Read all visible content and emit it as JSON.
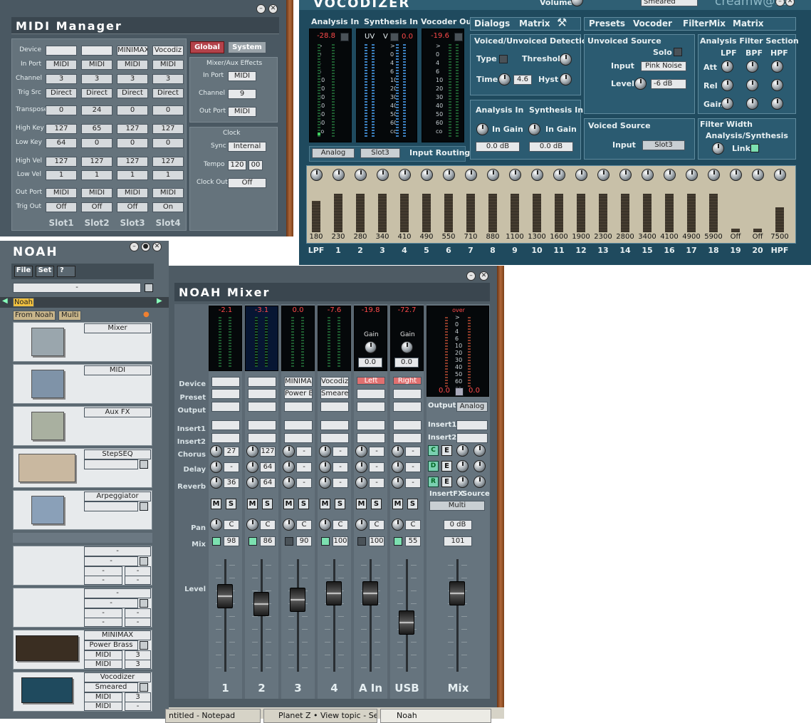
{
  "midi_manager": {
    "title": "MIDI Manager",
    "row_labels": [
      "Device",
      "In Port",
      "Channel",
      "Trig Src",
      "Transpose",
      "High Key",
      "Low Key",
      "High Vel",
      "Low Vel",
      "Out Port",
      "Trig Out"
    ],
    "slots": [
      {
        "name": "Slot1",
        "device": "",
        "in_port": "MIDI",
        "channel": "3",
        "trig_src": "Direct",
        "transpose": "0",
        "high_key": "127",
        "low_key": "64",
        "high_vel": "127",
        "low_vel": "1",
        "out_port": "MIDI",
        "trig_out": "Off"
      },
      {
        "name": "Slot2",
        "device": "",
        "in_port": "MIDI",
        "channel": "3",
        "trig_src": "Direct",
        "transpose": "24",
        "high_key": "65",
        "low_key": "0",
        "high_vel": "127",
        "low_vel": "1",
        "out_port": "MIDI",
        "trig_out": "Off"
      },
      {
        "name": "Slot3",
        "device": "MINIMAX",
        "in_port": "MIDI",
        "channel": "3",
        "trig_src": "Direct",
        "transpose": "0",
        "high_key": "127",
        "low_key": "0",
        "high_vel": "127",
        "low_vel": "1",
        "out_port": "MIDI",
        "trig_out": "Off"
      },
      {
        "name": "Slot4",
        "device": "Vocodiz",
        "in_port": "MIDI",
        "channel": "3",
        "trig_src": "Direct",
        "transpose": "0",
        "high_key": "127",
        "low_key": "0",
        "high_vel": "127",
        "low_vel": "1",
        "out_port": "MIDI",
        "trig_out": "On"
      }
    ],
    "global_btn": "Global",
    "system_btn": "System",
    "aux": {
      "title": "Mixer/Aux Effects",
      "in_port_label": "In Port",
      "in_port": "MIDI",
      "channel_label": "Channel",
      "channel": "9",
      "out_port_label": "Out Port",
      "out_port": "MIDI"
    },
    "clock": {
      "title": "Clock",
      "sync_label": "Sync",
      "sync": "Internal",
      "tempo_label": "Tempo",
      "tempo": "120",
      "tempo_frac": "00",
      "clock_out_label": "Clock Out",
      "clock_out": "Off"
    }
  },
  "vocodizer": {
    "title": "VOCODIZER",
    "volume_label": "Volume",
    "preset_field": "Smeared",
    "brand": "creamw@re",
    "analysis_in": {
      "label": "Analysis In",
      "peak": "-28.8"
    },
    "synthesis_in": {
      "label": "Synthesis In",
      "uv": "UV",
      "v": "V",
      "peak": "0.0"
    },
    "vocoder_out": {
      "label": "Vocoder Out",
      "peak": "-19.6"
    },
    "scale": [
      ">",
      "0",
      "4",
      "6",
      "10",
      "20",
      "30",
      "40",
      "50",
      "60",
      "co"
    ],
    "routing": {
      "analog": "Analog",
      "slot": "Slot3",
      "label": "Input Routing"
    },
    "tabs_left": [
      "Dialogs",
      "Matrix"
    ],
    "tabs_right": [
      "Presets",
      "Vocoder",
      "FilterMix",
      "Matrix"
    ],
    "vuv": {
      "title": "Voiced/Unvoiced Detection",
      "type": "Type",
      "threshold": "Threshold",
      "time": "Time",
      "time_val": "4.6",
      "hyst": "Hyst"
    },
    "unvoiced": {
      "title": "Unvoiced Source",
      "solo": "Solo",
      "input_label": "Input",
      "input": "Pink Noise",
      "level_label": "Level",
      "level": "-6 dB"
    },
    "analysis_filter": {
      "title": "Analysis Filter Section",
      "cols": [
        "LPF",
        "BPF",
        "HPF"
      ],
      "rows": [
        "Att",
        "Rel",
        "Gain"
      ]
    },
    "gain": {
      "analysis_title": "Analysis In",
      "synthesis_title": "Synthesis In",
      "in_gain": "In Gain",
      "analysis_val": "0.0 dB",
      "synthesis_val": "0.0 dB"
    },
    "voiced": {
      "title": "Voiced Source",
      "input_label": "Input",
      "input": "Slot3"
    },
    "width": {
      "title": "Filter Width",
      "sub": "Analysis/Synthesis",
      "link": "Link"
    },
    "bands": {
      "freqs": [
        "180",
        "230",
        "280",
        "340",
        "410",
        "490",
        "550",
        "710",
        "880",
        "1100",
        "1300",
        "1600",
        "1900",
        "2300",
        "2800",
        "3400",
        "4100",
        "4900",
        "5900",
        "Off",
        "Off",
        "7500"
      ],
      "numbers": [
        "LPF",
        "1",
        "2",
        "3",
        "4",
        "5",
        "6",
        "7",
        "8",
        "9",
        "10",
        "11",
        "12",
        "13",
        "14",
        "15",
        "16",
        "17",
        "18",
        "19",
        "20",
        "HPF"
      ],
      "levels": [
        0.68,
        0.84,
        0.84,
        0.84,
        0.84,
        0.84,
        0.84,
        0.84,
        0.84,
        0.84,
        0.84,
        0.84,
        0.84,
        0.84,
        0.84,
        0.84,
        0.84,
        0.84,
        0.84,
        0.08,
        0.08,
        0.55
      ]
    }
  },
  "noah": {
    "title": "NOAH",
    "menu": [
      "File",
      "Set",
      "?"
    ],
    "dash": "-",
    "name": "Noah",
    "tab_from": "From Noah",
    "tab_multi": "Multi",
    "slots": [
      {
        "name": "Mixer"
      },
      {
        "name": "MIDI"
      },
      {
        "name": "Aux FX"
      },
      {
        "name": "StepSEQ",
        "sub": ""
      },
      {
        "name": "Arpeggiator",
        "sub": ""
      }
    ],
    "empty_slot": {
      "name": "-",
      "sub": "-",
      "a": "-",
      "b": "-",
      "c": "-",
      "d": "-"
    },
    "devices": [
      {
        "name": "MINIMAX",
        "preset": "Power Brass",
        "p1": "MIDI",
        "c1": "3",
        "p2": "MIDI",
        "c2": "3"
      },
      {
        "name": "Vocodizer",
        "preset": "Smeared",
        "p1": "MIDI",
        "c1": "3",
        "p2": "MIDI",
        "c2": "-"
      }
    ]
  },
  "mixer": {
    "title": "NOAH Mixer",
    "row_labels": {
      "device": "Device",
      "preset": "Preset",
      "output": "Output",
      "insert1": "Insert1",
      "insert2": "Insert2",
      "chorus": "Chorus",
      "delay": "Delay",
      "reverb": "Reverb",
      "pan": "Pan",
      "mix": "Mix",
      "level": "Level"
    },
    "channels": [
      {
        "name": "1",
        "peak": "-2.1",
        "device": "",
        "preset": "",
        "output": "",
        "chorus": "27",
        "delay": "-",
        "reverb": "36",
        "pan": "C",
        "mix": "98",
        "mix_on": true,
        "level": 0.72
      },
      {
        "name": "2",
        "peak": "-3.1",
        "device": "",
        "preset": "",
        "output": "",
        "chorus": "127",
        "delay": "64",
        "reverb": "64",
        "pan": "C",
        "mix": "86",
        "mix_on": true,
        "level": 0.63
      },
      {
        "name": "3",
        "peak": "0.0",
        "device": "MINIMAX",
        "preset": "Power B",
        "output": "",
        "chorus": "-",
        "delay": "-",
        "reverb": "-",
        "pan": "C",
        "mix": "90",
        "mix_on": false,
        "level": 0.68
      },
      {
        "name": "4",
        "peak": "-7.6",
        "device": "Vocodiz",
        "preset": "Smeared",
        "output": "",
        "chorus": "-",
        "delay": "-",
        "reverb": "-",
        "pan": "C",
        "mix": "100",
        "mix_on": true,
        "level": 0.75
      },
      {
        "name": "A In",
        "peak": "-19.8",
        "device": "Left",
        "preset": "",
        "output": "",
        "gain": "Gain",
        "gain_val": "0.0",
        "chorus": "-",
        "delay": "-",
        "reverb": "-",
        "pan": "C",
        "mix": "100",
        "mix_on": false,
        "level": 0.75
      },
      {
        "name": "USB",
        "peak": "-72.7",
        "device": "Right",
        "preset": "",
        "output": "",
        "gain": "Gain",
        "gain_val": "0.0",
        "chorus": "-",
        "delay": "-",
        "reverb": "-",
        "pan": "C",
        "mix": "55",
        "mix_on": true,
        "level": 0.42
      }
    ],
    "master": {
      "over": "over",
      "l": "0.0",
      "r": "0.0",
      "output_label": "Output",
      "output": "Analog",
      "insert1": "Insert1",
      "insert2": "Insert2",
      "c": "C",
      "d": "D",
      "r_btn": "R",
      "e": "E",
      "insertfx": "InsertFX",
      "source": "Source",
      "multi": "Multi",
      "db": "0 dB",
      "mix_val": "101",
      "name": "Mix",
      "level": 0.75
    },
    "ms": {
      "m": "M",
      "s": "S"
    },
    "scale": [
      ">",
      "0",
      "4",
      "6",
      "10",
      "20",
      "30",
      "40",
      "50",
      "60",
      "co"
    ]
  },
  "taskbar": [
    {
      "label": "ntitled - Notepad"
    },
    {
      "label": "Planet Z • View topic - Se..."
    },
    {
      "label": "Noah"
    }
  ]
}
